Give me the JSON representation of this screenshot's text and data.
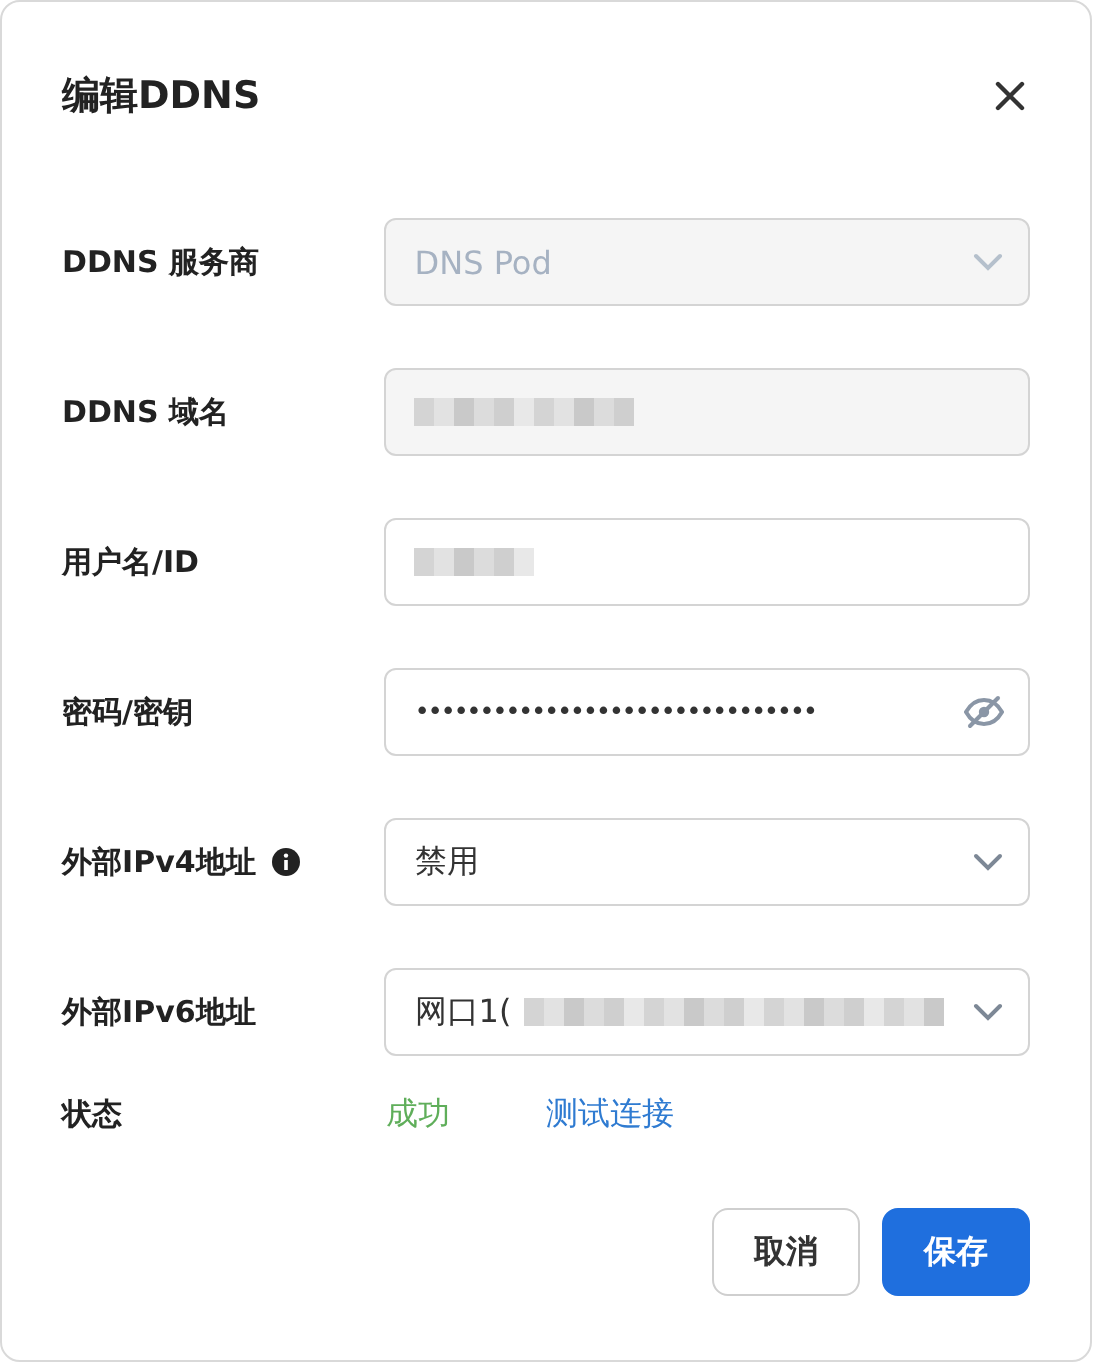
{
  "dialog": {
    "title": "编辑DDNS",
    "fields": [
      {
        "kind": "select",
        "label": "DDNS 服务商",
        "value": "DNS Pod",
        "disabled": true
      },
      {
        "kind": "text",
        "label": "DDNS 域名",
        "redacted": true,
        "disabled": true
      },
      {
        "kind": "text",
        "label": "用户名/ID",
        "redacted": true,
        "disabled": false
      },
      {
        "kind": "password",
        "label": "密码/密钥",
        "value": "•••••••••••••••••••••••••••••••",
        "disabled": false
      },
      {
        "kind": "select",
        "label": "外部IPv4地址",
        "info": true,
        "value": "禁用",
        "disabled": false
      },
      {
        "kind": "select",
        "label": "外部IPv6地址",
        "value": "网口1(",
        "redacted": true,
        "disabled": false
      }
    ],
    "status": {
      "label": "状态",
      "value": "成功",
      "link": "测试连接"
    },
    "buttons": [
      {
        "label": "取消",
        "primary": false
      },
      {
        "label": "保存",
        "primary": true
      }
    ]
  }
}
